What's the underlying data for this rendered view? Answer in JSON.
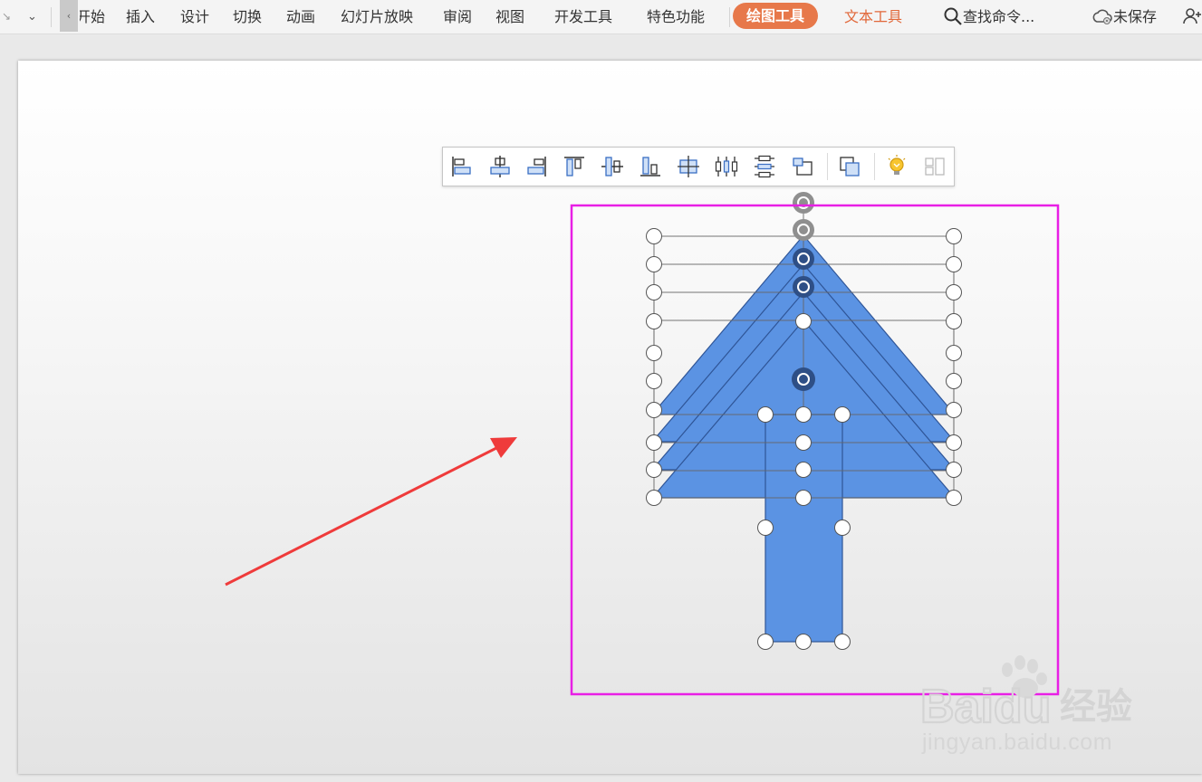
{
  "ribbon": {
    "tabs": [
      "开始",
      "插入",
      "设计",
      "切换",
      "动画",
      "幻灯片放映",
      "审阅",
      "视图",
      "开发工具",
      "特色功能"
    ],
    "active_tab": "绘图工具",
    "extra_tab": "文本工具",
    "search_label": "查找命令...",
    "save_status": "未保存",
    "colors": {
      "active_bg": "#e7784a",
      "extra_text": "#e1683a"
    }
  },
  "align_toolbar": {
    "buttons": [
      "align-left-icon",
      "align-center-icon",
      "align-right-icon",
      "align-top-icon",
      "align-middle-icon",
      "align-bottom-icon",
      "center-on-slide-icon",
      "distribute-horizontally-icon",
      "distribute-vertically-icon",
      "rotate-icon",
      "combine-icon",
      "smart-idea-icon",
      "layout-split-icon"
    ]
  },
  "slide": {
    "arrow_color": "#5b93e3",
    "selection_frame_color": "#e81fe5",
    "annotation_arrow_color": "#ef3b3b"
  },
  "watermark": {
    "brand": "Baidu",
    "brand_cn": "经验",
    "url": "jingyan.baidu.com"
  }
}
